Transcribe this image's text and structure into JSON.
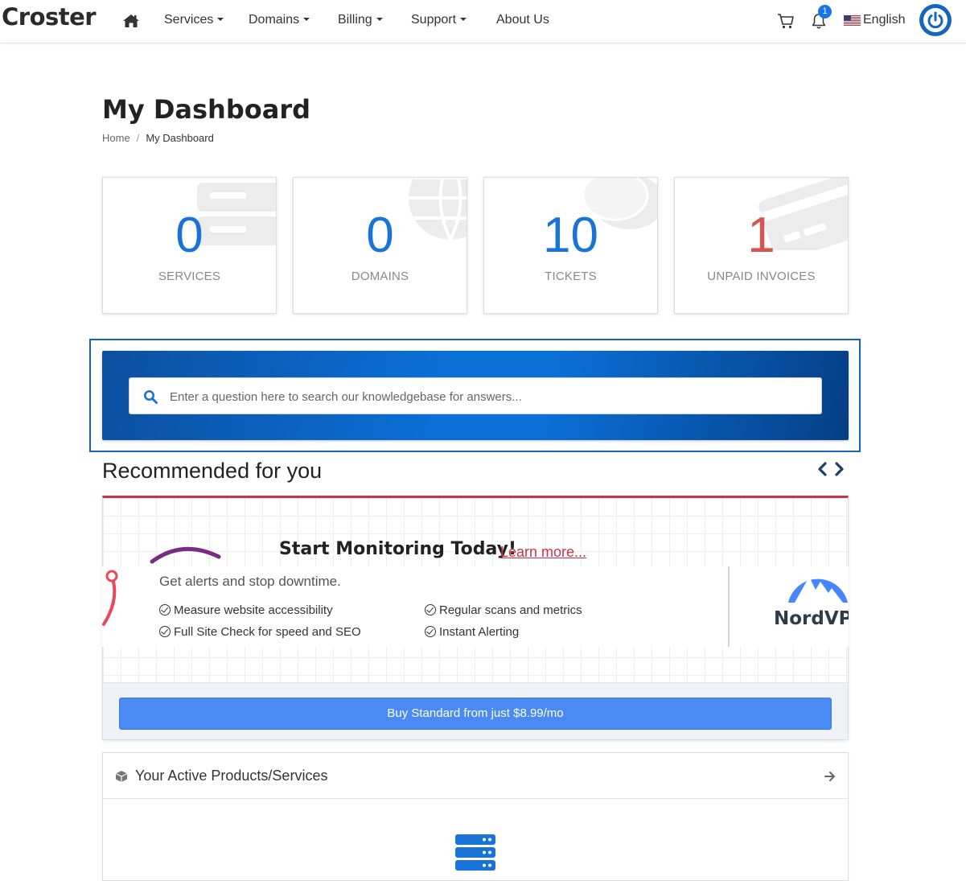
{
  "header": {
    "logo": "Croster",
    "nav": [
      {
        "label": "Services",
        "has_caret": true
      },
      {
        "label": "Domains",
        "has_caret": true
      },
      {
        "label": "Billing",
        "has_caret": true
      },
      {
        "label": "Support",
        "has_caret": true
      },
      {
        "label": "About Us",
        "has_caret": false
      }
    ],
    "notification_count": "1",
    "language": "English",
    "icons": [
      "home-icon",
      "cart-icon",
      "bell-icon",
      "us-flag-icon",
      "power-icon"
    ]
  },
  "page": {
    "title": "My Dashboard",
    "breadcrumb": {
      "home": "Home",
      "separator": "/",
      "current": "My Dashboard"
    }
  },
  "stats": [
    {
      "value": "0",
      "label": "SERVICES",
      "icon": "server-icon"
    },
    {
      "value": "0",
      "label": "DOMAINS",
      "icon": "globe-icon"
    },
    {
      "value": "10",
      "label": "TICKETS",
      "icon": "comments-icon"
    },
    {
      "value": "1",
      "label": "UNPAID INVOICES",
      "icon": "credit-card-icon",
      "accent": "#d9534f"
    }
  ],
  "search": {
    "placeholder": "Enter a question here to search our knowledgebase for answers..."
  },
  "recommended": {
    "title": "Recommended for you",
    "headline": "Start Monitoring Today!",
    "learn_more": "Learn more...",
    "subtitle": "Get alerts and stop downtime.",
    "features": [
      "Measure website accessibility",
      "Regular scans and metrics",
      "Full Site Check for speed and SEO",
      "Instant Alerting"
    ],
    "partner_logo_text": "NordVP",
    "cta": "Buy Standard from just $8.99/mo",
    "accent": "#c7354b"
  },
  "active_products": {
    "title": "Your Active Products/Services"
  },
  "colors": {
    "primary": "#1a73d9",
    "banner_dark": "#053f86",
    "button": "#4a8af4"
  }
}
